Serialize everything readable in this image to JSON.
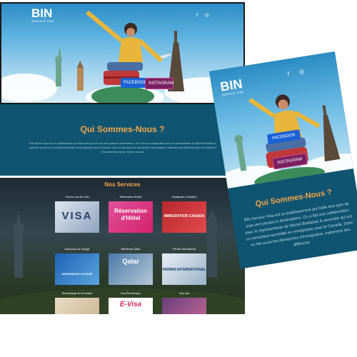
{
  "desktop": {
    "logo_mark": "BIN",
    "logo_sub": "SERVICE VISA",
    "social_buttons": {
      "facebook": "FACEBOOK",
      "instagram": "INSTAGRAM"
    },
    "about": {
      "title": "Qui Sommes-Nous ?",
      "text": "BIN Service Visa est un établissement qui traite tout type de visa vers plusieurs destinations. On a fait une collaboration avec le représentante de Michel Bediahan & associée qui est un consultant accrédité en immigration pour le Canada. Donc on fait aussi les démarches d'immigration, traitement des différents types de résidence temporaire (tourisme, études, travail)."
    },
    "services": {
      "title": "Nos Services",
      "items": [
        {
          "label": "Service visa De Visa",
          "caption": "VISA"
        },
        {
          "label": "Réservation d'hôtel",
          "caption": "Réservation d'Hôtel"
        },
        {
          "label": "Immigration CANADA",
          "caption": "IMMIGRATION CANADA"
        },
        {
          "label": "Assurance de Voyage",
          "caption": "ASSURANCE VOYAGE"
        },
        {
          "label": "Résidence Qatar",
          "caption": "Qatar"
        },
        {
          "label": "Permis International",
          "caption": "PERMIS INTERNATIONAL"
        },
        {
          "label": "Remplissage de formulaire",
          "caption": ""
        },
        {
          "label": "Visa Électronique",
          "caption": "E-Visa"
        },
        {
          "label": "Visa Usa",
          "caption": ""
        }
      ]
    }
  },
  "mobile": {
    "logo_mark": "BIN",
    "logo_sub": "SERVICE VISA",
    "social_buttons": {
      "facebook": "FACEBOOK",
      "instagram": "INSTAGRAM"
    },
    "about": {
      "title": "Qui Sommes-Nous ?",
      "text": "BIN Service Visa est un établissement qui traite tout type de visa vers plusieurs destinations. On a fait une collaboration avec le représentante de Michel Bediahan & associée qui est un consultant accrédité en immigration pour le Canada. Donc on fait aussi les démarches d'immigration, traitement des différents"
    }
  },
  "colors": {
    "accent": "#f4a64a",
    "band": "#0f5470",
    "facebook": "#1b62d6",
    "instagram": "#7a2060"
  }
}
